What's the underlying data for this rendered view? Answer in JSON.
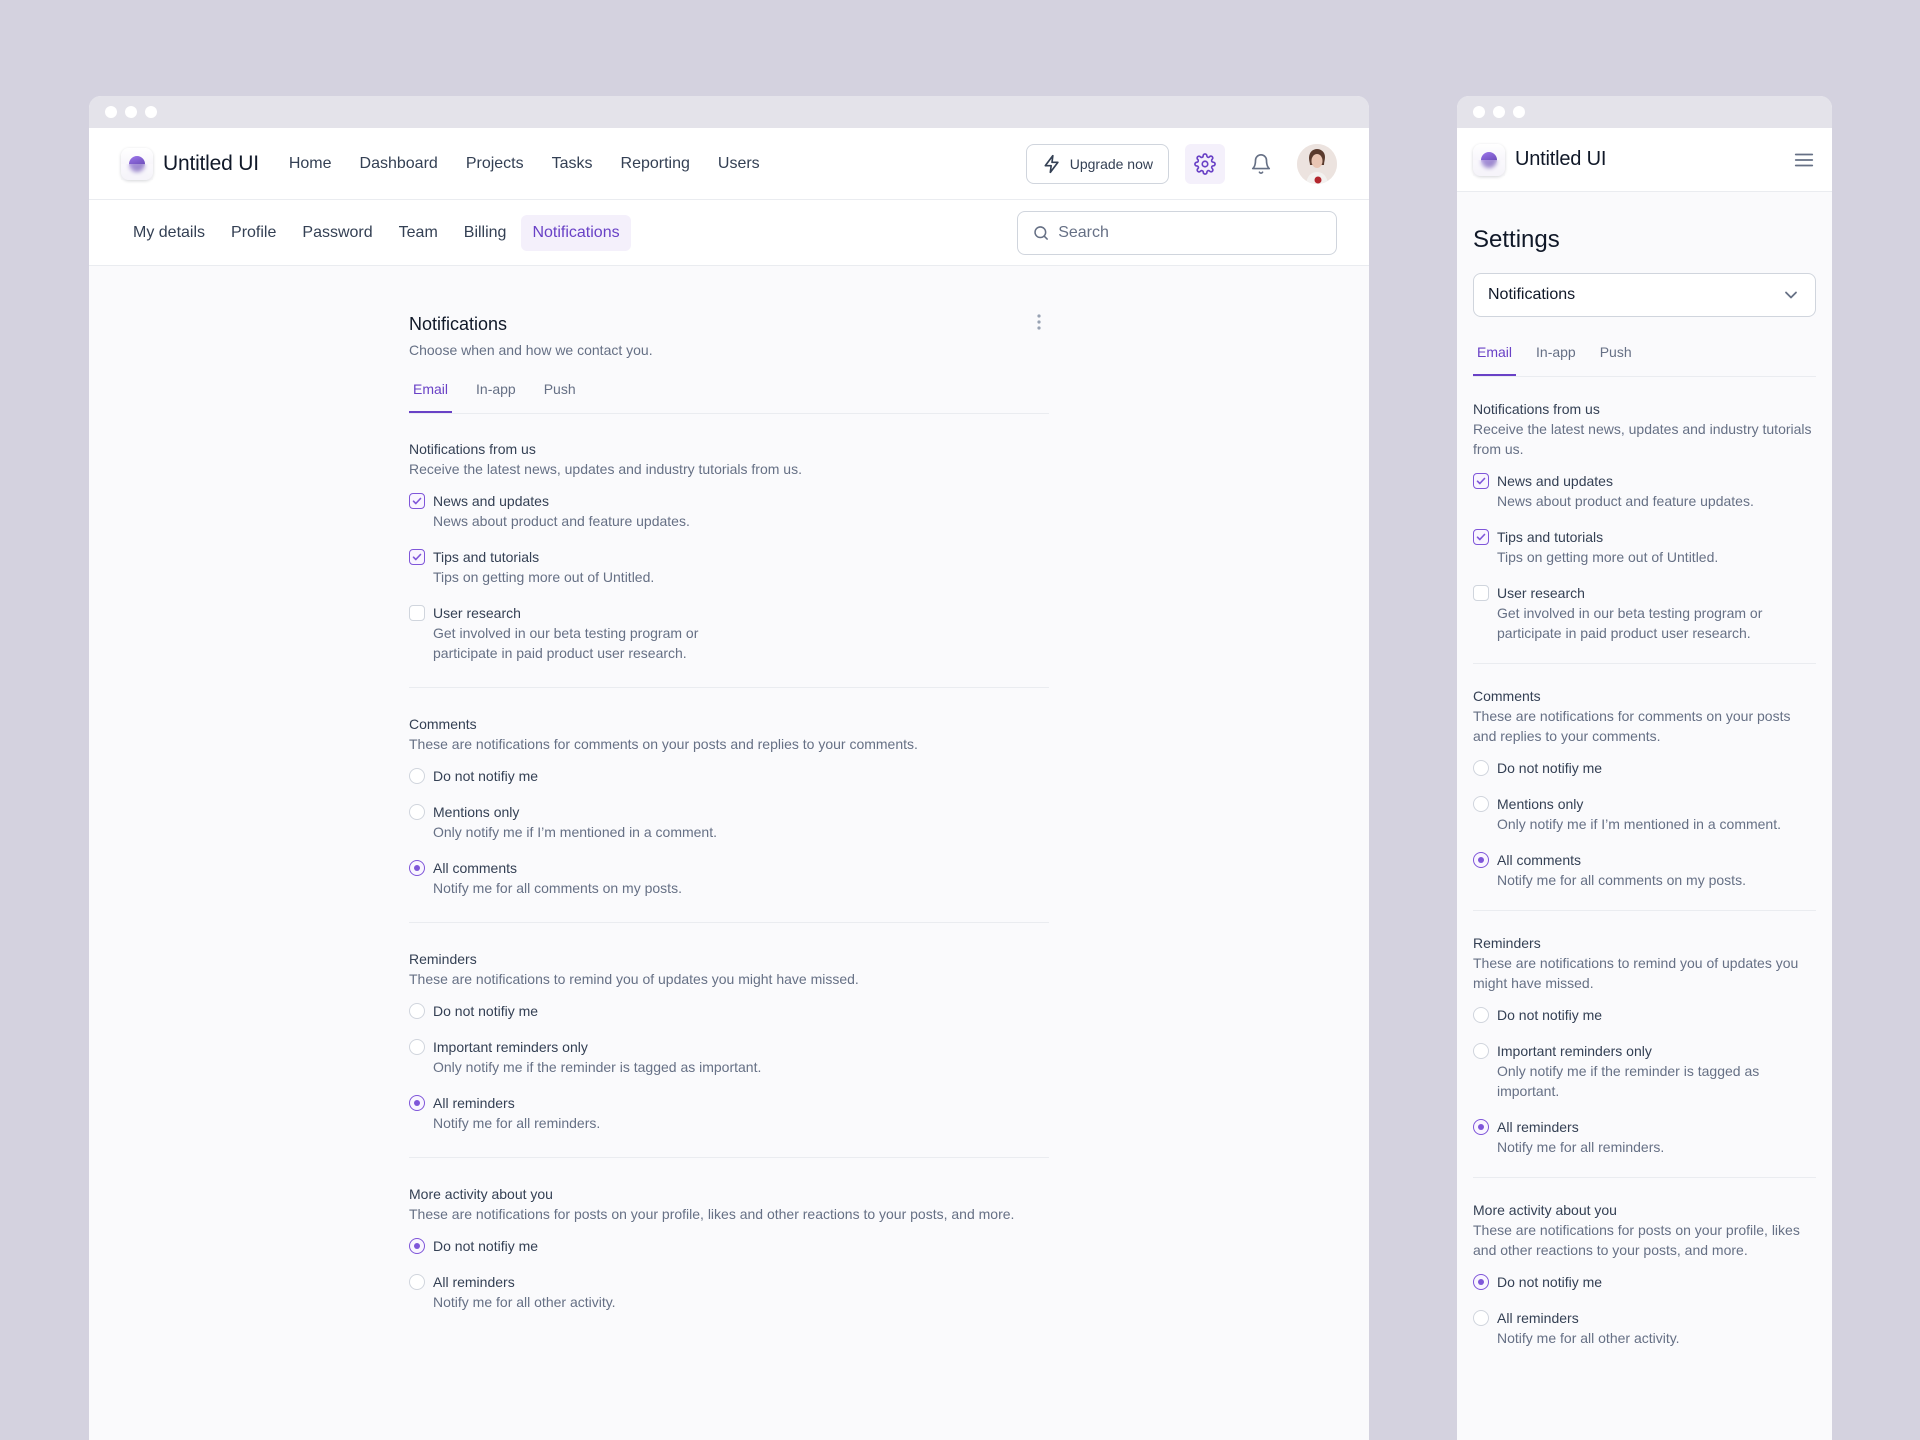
{
  "desktop": {
    "app_name": "Untitled UI",
    "nav": [
      "Home",
      "Dashboard",
      "Projects",
      "Tasks",
      "Reporting",
      "Users"
    ],
    "upgrade_label": "Upgrade now",
    "settings_tabs": [
      "My details",
      "Profile",
      "Password",
      "Team",
      "Billing",
      "Notifications"
    ],
    "active_settings_tab": "Notifications",
    "search_placeholder": "Search",
    "section_title": "Notifications",
    "section_subtitle": "Choose when and how we contact you."
  },
  "channel_tabs": [
    "Email",
    "In-app",
    "Push"
  ],
  "active_channel": "Email",
  "groups": {
    "from_us": {
      "title": "Notifications from us",
      "desc": "Receive the latest news, updates and industry tutorials from us.",
      "options": [
        {
          "label": "News and updates",
          "hint": "News about product and feature updates.",
          "checked": true
        },
        {
          "label": "Tips and tutorials",
          "hint": "Tips on getting more out of Untitled.",
          "checked": true
        },
        {
          "label": "User research",
          "hint": "Get involved in our beta testing program or participate in paid product user research.",
          "checked": false
        }
      ]
    },
    "comments": {
      "title": "Comments",
      "desc": "These are notifications for comments on your posts and replies to your comments.",
      "options": [
        {
          "label": "Do not notifiy me",
          "hint": "",
          "selected": false
        },
        {
          "label": "Mentions only",
          "hint": "Only notify me if I’m mentioned in a comment.",
          "selected": false
        },
        {
          "label": "All comments",
          "hint": "Notify me for all comments on my posts.",
          "selected": true
        }
      ]
    },
    "reminders": {
      "title": "Reminders",
      "desc": "These are notifications to remind you of updates you might have missed.",
      "options": [
        {
          "label": "Do not notifiy me",
          "hint": "",
          "selected": false
        },
        {
          "label": "Important reminders only",
          "hint": "Only notify me if the reminder is tagged as important.",
          "selected": false
        },
        {
          "label": "All reminders",
          "hint": "Notify me for all reminders.",
          "selected": true
        }
      ]
    },
    "activity": {
      "title": "More activity about you",
      "desc": "These are notifications for posts on your profile, likes and other reactions to your posts, and more.",
      "options": [
        {
          "label": "Do not notifiy me",
          "hint": "",
          "selected": true
        },
        {
          "label": "All reminders",
          "hint": "Notify me for all other activity.",
          "selected": false
        }
      ]
    }
  },
  "mobile": {
    "app_name": "Untitled UI",
    "page_title": "Settings",
    "select_value": "Notifications"
  },
  "colors": {
    "accent": "#7f56d9",
    "accent_text": "#6941c6",
    "backdrop": "#d4d2df"
  },
  "icons": [
    "lightning-icon",
    "gear-icon",
    "bell-icon",
    "search-icon",
    "kebab-icon",
    "menu-icon",
    "chevron-down-icon",
    "check-icon"
  ]
}
